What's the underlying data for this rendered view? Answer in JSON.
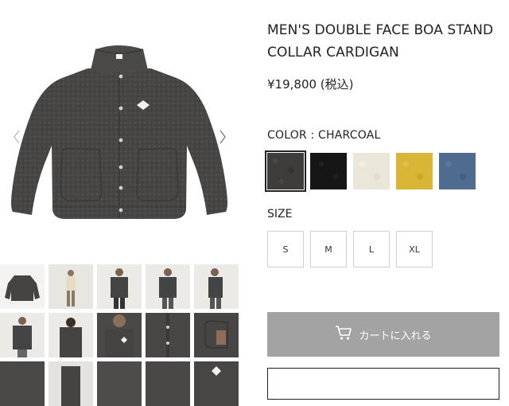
{
  "product": {
    "title": "MEN'S DOUBLE FACE BOA STAND\nCOLLAR CARDIGAN",
    "price": "¥19,800 (税込)"
  },
  "color": {
    "label": "COLOR : CHARCOAL",
    "swatches": [
      {
        "name": "charcoal",
        "color": "#3f3d3b",
        "selected": true
      },
      {
        "name": "black",
        "color": "#161616",
        "selected": false
      },
      {
        "name": "ivory",
        "color": "#ebe6da",
        "selected": false
      },
      {
        "name": "yellow",
        "color": "#d8b535",
        "selected": false
      },
      {
        "name": "blue",
        "color": "#4f6b8f",
        "selected": false
      }
    ]
  },
  "size": {
    "label": "SIZE",
    "options": [
      "S",
      "M",
      "L",
      "XL"
    ]
  },
  "cart": {
    "label": "カートに入れる",
    "icon": "cart-icon"
  },
  "gallery": {
    "prev_icon": "chevron-left-icon",
    "next_icon": "chevron-right-icon",
    "thumbnail_count": 15
  },
  "colors": {
    "jacket": "#464544",
    "cart_button_bg": "#a3a3a3",
    "thumb_bg": "#eceae6"
  }
}
